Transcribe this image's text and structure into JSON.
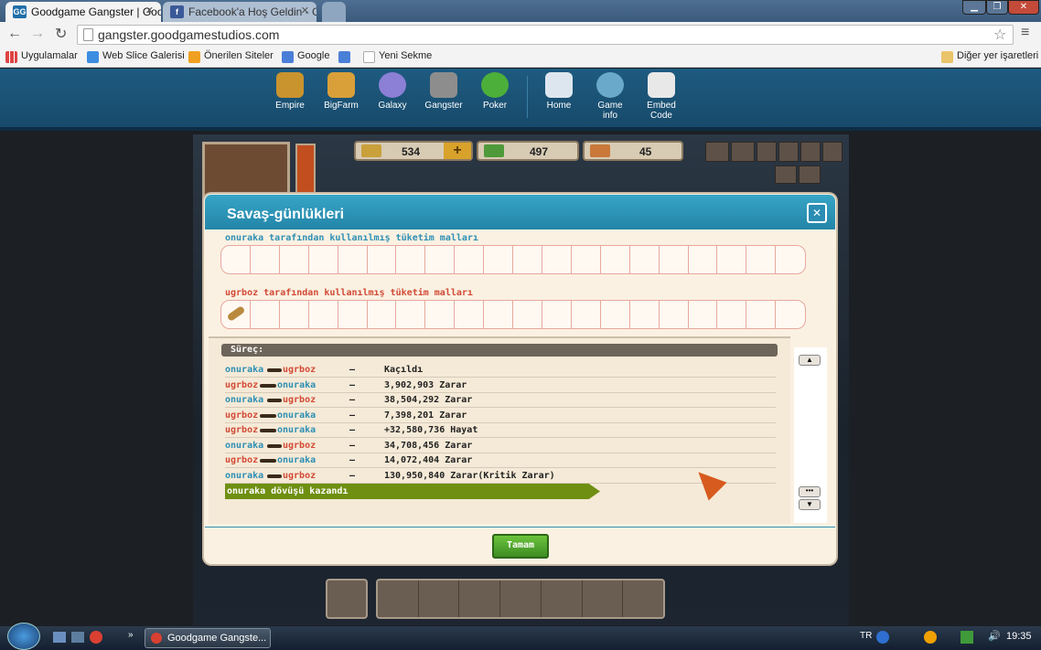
{
  "browser": {
    "tabs": [
      {
        "label": "Goodgame Gangster | Goo",
        "active": true
      },
      {
        "label": "Facebook'a Hoş Geldin - G",
        "active": false
      }
    ],
    "url": "gangster.goodgamestudios.com",
    "bookmarks": [
      "Uygulamalar",
      "Web Slice Galerisi",
      "Önerilen Siteler",
      "Google",
      "Yeni Sekme"
    ],
    "other_bookmarks": "Diğer yer işaretleri"
  },
  "ggs_nav": {
    "games": [
      "Empire",
      "BigFarm",
      "Galaxy",
      "Gangster",
      "Poker"
    ],
    "links": [
      "Home",
      "Game\ninfo",
      "Embed\nCode"
    ],
    "links_line1": [
      "Home",
      "Game",
      "Embed"
    ],
    "links_line2": [
      "",
      "info",
      "Code"
    ]
  },
  "resources": {
    "cash": "534",
    "gold": "497",
    "ammo": "45"
  },
  "dialog": {
    "title": "Savaş-günlükleri",
    "consumables_player1": "onuraka tarafından kullanılmış tüketim malları",
    "consumables_player2": "ugrboz tarafından kullanılmış tüketim malları",
    "process_header": "Süreç:",
    "log": [
      {
        "a": "onuraka",
        "b": "ugrboz",
        "a_color": "blue",
        "sep": "–",
        "result": "Kaçıldı"
      },
      {
        "a": "ugrboz",
        "b": "onuraka",
        "a_color": "red",
        "sep": "–",
        "result": "3,902,903 Zarar"
      },
      {
        "a": "onuraka",
        "b": "ugrboz",
        "a_color": "blue",
        "sep": "–",
        "result": "38,504,292 Zarar"
      },
      {
        "a": "ugrboz",
        "b": "onuraka",
        "a_color": "red",
        "sep": "–",
        "result": "7,398,201 Zarar"
      },
      {
        "a": "ugrboz",
        "b": "onuraka",
        "a_color": "red",
        "sep": "–",
        "result": "+32,580,736 Hayat"
      },
      {
        "a": "onuraka",
        "b": "ugrboz",
        "a_color": "blue",
        "sep": "–",
        "result": "34,708,456 Zarar"
      },
      {
        "a": "ugrboz",
        "b": "onuraka",
        "a_color": "red",
        "sep": "–",
        "result": "14,072,404 Zarar"
      },
      {
        "a": "onuraka",
        "b": "ugrboz",
        "a_color": "blue",
        "sep": "–",
        "result": "130,950,840 Zarar(Kritik Zarar)"
      }
    ],
    "winner_banner": "onuraka dövüşü kazandı",
    "ok_button": "Tamam"
  },
  "taskbar": {
    "window_label": "Goodgame Gangste...",
    "lang": "TR",
    "clock": "19:35"
  },
  "colors": {
    "accent": "#2385a8",
    "win_banner": "#6f8f12",
    "ok": "#4a9c2b"
  }
}
